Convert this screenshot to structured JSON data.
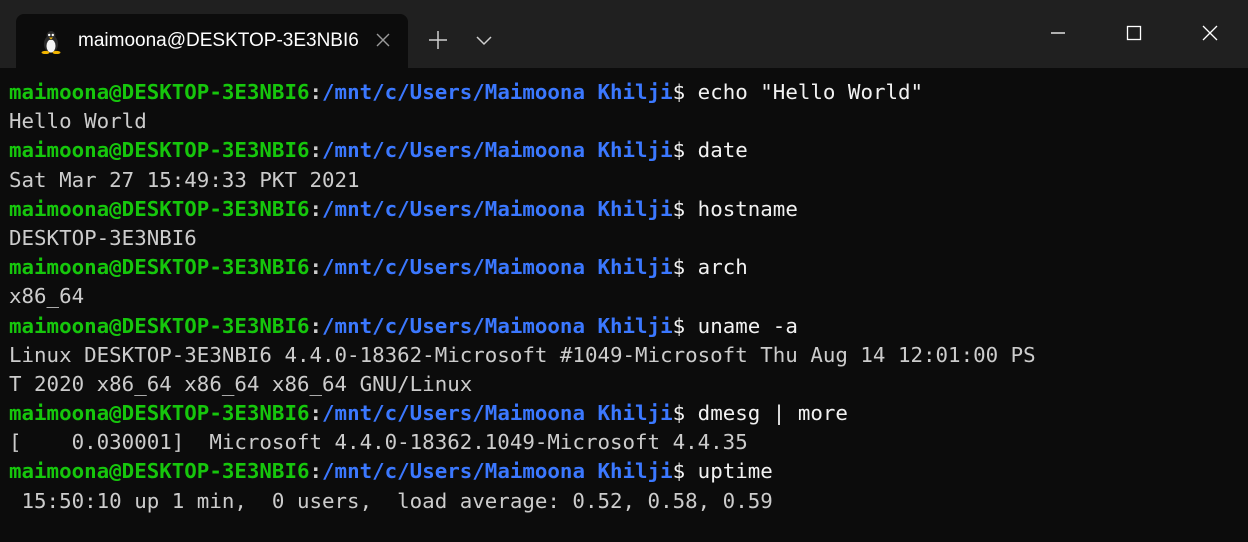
{
  "window": {
    "tab_title": "maimoona@DESKTOP-3E3NBI6",
    "tab_icon": "tux-linux-icon",
    "controls": {
      "close_tab_icon": "close-icon",
      "new_tab_icon": "plus-icon",
      "dropdown_icon": "chevron-down-icon",
      "minimize_icon": "minimize-icon",
      "maximize_icon": "maximize-icon",
      "close_window_icon": "close-icon"
    }
  },
  "colors": {
    "background": "#0c0c0c",
    "titlebar": "#202020",
    "prompt_user": "#16c60c",
    "prompt_path": "#3b78ff",
    "text": "#cccccc"
  },
  "prompt": {
    "user_host": "maimoona@DESKTOP-3E3NBI6",
    "separator": ":",
    "path": "/mnt/c/Users/Maimoona Khilji",
    "symbol": "$ "
  },
  "terminal": {
    "lines": [
      {
        "type": "cmd",
        "text": "echo \"Hello World\""
      },
      {
        "type": "out",
        "text": "Hello World"
      },
      {
        "type": "cmd",
        "text": "date"
      },
      {
        "type": "out",
        "text": "Sat Mar 27 15:49:33 PKT 2021"
      },
      {
        "type": "cmd",
        "text": "hostname"
      },
      {
        "type": "out",
        "text": "DESKTOP-3E3NBI6"
      },
      {
        "type": "cmd",
        "text": "arch"
      },
      {
        "type": "out",
        "text": "x86_64"
      },
      {
        "type": "cmd",
        "text": "uname -a"
      },
      {
        "type": "out",
        "text": "Linux DESKTOP-3E3NBI6 4.4.0-18362-Microsoft #1049-Microsoft Thu Aug 14 12:01:00 PS"
      },
      {
        "type": "out",
        "text": "T 2020 x86_64 x86_64 x86_64 GNU/Linux"
      },
      {
        "type": "cmd",
        "text": "dmesg | more"
      },
      {
        "type": "out",
        "text": "[    0.030001]  Microsoft 4.4.0-18362.1049-Microsoft 4.4.35"
      },
      {
        "type": "cmd",
        "text": "uptime"
      },
      {
        "type": "out",
        "text": " 15:50:10 up 1 min,  0 users,  load average: 0.52, 0.58, 0.59"
      }
    ]
  }
}
